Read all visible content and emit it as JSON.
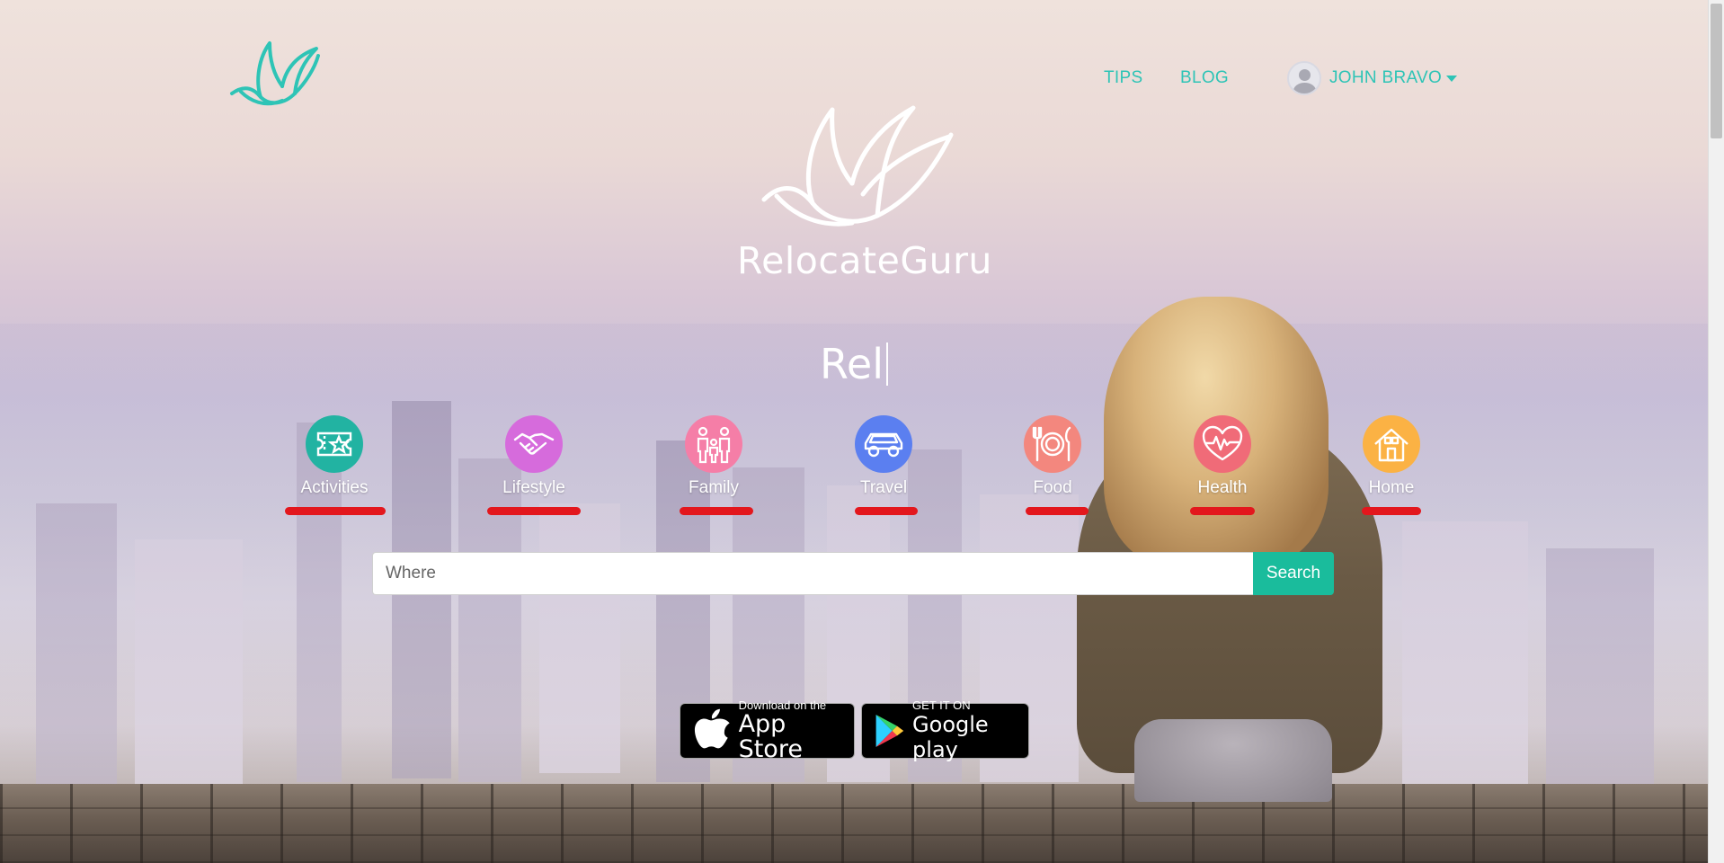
{
  "nav": {
    "tips": "TIPS",
    "blog": "BLOG",
    "user_name": "JOHN BRAVO"
  },
  "hero": {
    "brand": "RelocateGuru",
    "typed_text": "Rel"
  },
  "categories": [
    {
      "label": "Activities",
      "color": "#22b3a2",
      "icon": "ticket-star-icon"
    },
    {
      "label": "Lifestyle",
      "color": "#d66bdc",
      "icon": "handshake-icon"
    },
    {
      "label": "Family",
      "color": "#f57ea7",
      "icon": "family-icon"
    },
    {
      "label": "Travel",
      "color": "#5b7ff0",
      "icon": "car-icon"
    },
    {
      "label": "Food",
      "color": "#f3877e",
      "icon": "plate-cutlery-icon"
    },
    {
      "label": "Health",
      "color": "#f06b78",
      "icon": "heart-pulse-icon"
    },
    {
      "label": "Home",
      "color": "#fbb244",
      "icon": "house-icon"
    }
  ],
  "search": {
    "placeholder": "Where",
    "button": "Search"
  },
  "stores": {
    "apple_small": "Download on the",
    "apple_large": "App Store",
    "google_small": "GET IT ON",
    "google_large": "Google play"
  },
  "colors": {
    "accent": "#2ec4b6",
    "search_button": "#1abc9c",
    "underline": "#e3171d"
  }
}
